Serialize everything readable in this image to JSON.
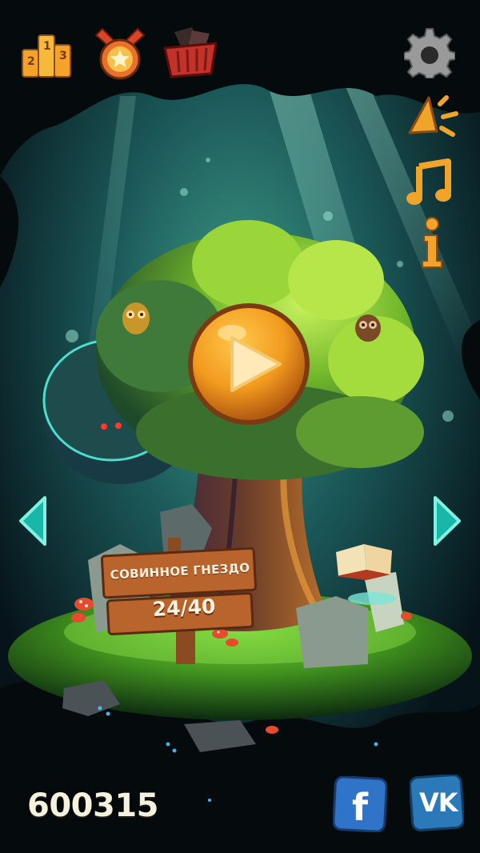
{
  "level": {
    "name": "СОВИННОЕ ГНЕЗДО",
    "progress": "24/40"
  },
  "score": "600315",
  "top_bar": {
    "leaderboard_icon": "podium-icon",
    "leaderboard_digits": [
      "2",
      "1",
      "3"
    ],
    "achievements_icon": "medal-icon",
    "shop_icon": "basket-icon"
  },
  "side_menu": {
    "settings_icon": "gear-icon",
    "sound_icon": "speaker-icon",
    "music_icon": "music-note-icon",
    "info_icon": "info-icon"
  },
  "social": {
    "facebook_label": "f",
    "vk_label": "vk"
  },
  "colors": {
    "gold": "#f2a42a",
    "teal_arrow": "#2fd6c6",
    "facebook_blue": "#2f74c8",
    "vk_blue": "#2b79b9"
  }
}
